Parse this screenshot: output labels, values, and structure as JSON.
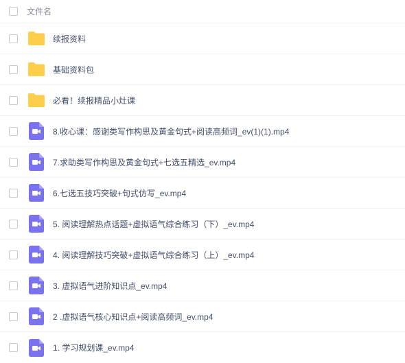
{
  "header": {
    "column_label": "文件名"
  },
  "colors": {
    "folder": "#fcce4a",
    "video": "#7b72f0"
  },
  "files": [
    {
      "name": "续报资料",
      "type": "folder",
      "icon": "folder-icon"
    },
    {
      "name": "基础资料包",
      "type": "folder",
      "icon": "folder-icon"
    },
    {
      "name": "必看！续报精品小灶课",
      "type": "folder",
      "icon": "folder-icon"
    },
    {
      "name": "8.收心课：感谢类写作构思及黄金句式+阅读高频词_ev(1)(1).mp4",
      "type": "video",
      "icon": "video-icon"
    },
    {
      "name": "7.求助类写作构思及黄金句式+七选五精选_ev.mp4",
      "type": "video",
      "icon": "video-icon"
    },
    {
      "name": "6.七选五技巧突破+句式仿写_ev.mp4",
      "type": "video",
      "icon": "video-icon"
    },
    {
      "name": "5. 阅读理解热点话题+虚拟语气综合练习（下）_ev.mp4",
      "type": "video",
      "icon": "video-icon"
    },
    {
      "name": "4. 阅读理解技巧突破+虚拟语气综合练习（上）_ev.mp4",
      "type": "video",
      "icon": "video-icon"
    },
    {
      "name": "3. 虚拟语气进阶知识点_ev.mp4",
      "type": "video",
      "icon": "video-icon"
    },
    {
      "name": "2 .虚拟语气核心知识点+阅读高频词_ev.mp4",
      "type": "video",
      "icon": "video-icon"
    },
    {
      "name": "1. 学习规划课_ev.mp4",
      "type": "video",
      "icon": "video-icon"
    }
  ]
}
